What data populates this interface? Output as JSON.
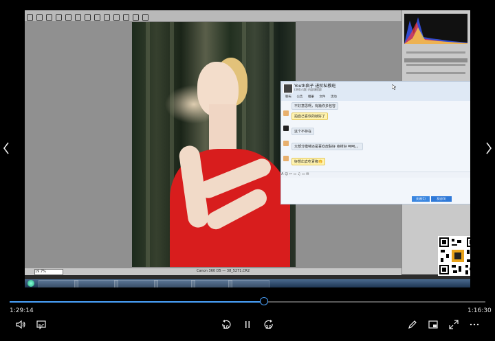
{
  "player": {
    "time_current": "1:29:14",
    "time_total": "1:16:30",
    "progress": 0.535,
    "skip_back_label": "10",
    "skip_forward_label": "30",
    "accent_color": "#4aa3ff"
  },
  "video": {
    "chat": {
      "title": "Youth疯子 进阶私教班",
      "subtitle": "(360人群) 内部课程群",
      "tabs": [
        "聊天",
        "公告",
        "相册",
        "文件",
        "活动"
      ],
      "messages": [
        {
          "text": "不好意思啊，有篇你多包容",
          "yellow": false
        },
        {
          "text": "拍自己喜欢的就好了",
          "yellow": true
        },
        {
          "text": "这个不存在",
          "yellow": false
        },
        {
          "text": "大部分模特还是喜欢皮肤好 身材好 呵呵。。",
          "yellow": false
        },
        {
          "text": "好想出去吃青椒🤭",
          "yellow": true
        }
      ],
      "send_label": "发送(S)",
      "close_label": "关闭(C)"
    },
    "statusbar": {
      "zoom": "19.7%",
      "info": "Canon 360 D5 — 38_5271.CR2"
    }
  },
  "icons": {
    "prev": "chevron-left-icon",
    "next": "chevron-right-icon",
    "volume": "volume-icon",
    "subtitles": "subtitles-icon",
    "skip_back": "skip-back-icon",
    "pause": "pause-icon",
    "skip_forward": "skip-forward-icon",
    "edit": "pencil-icon",
    "miniplayer": "miniplayer-icon",
    "fullscreen": "fullscreen-icon",
    "more": "more-icon"
  }
}
